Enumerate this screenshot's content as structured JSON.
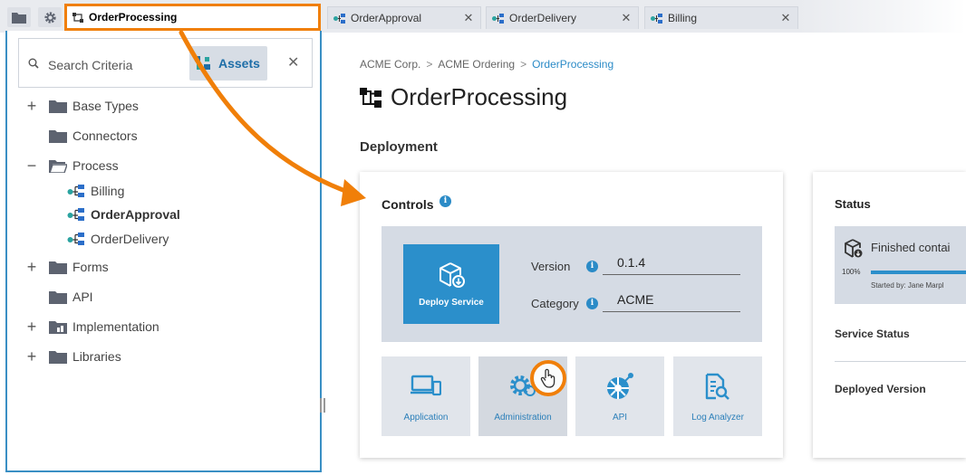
{
  "tabs": [
    {
      "label": "OrderProcessing",
      "active": true
    },
    {
      "label": "OrderApproval",
      "active": false
    },
    {
      "label": "OrderDelivery",
      "active": false
    },
    {
      "label": "Billing",
      "active": false
    }
  ],
  "sidebar": {
    "search_placeholder": "Search Criteria",
    "assets_label": "Assets",
    "tree": [
      {
        "label": "Base Types",
        "toggle": "+",
        "kind": "folder"
      },
      {
        "label": "Connectors",
        "toggle": "",
        "kind": "folder"
      },
      {
        "label": "Process",
        "toggle": "−",
        "kind": "folder-open"
      },
      {
        "label": "Billing",
        "kind": "process"
      },
      {
        "label": "OrderApproval",
        "kind": "process"
      },
      {
        "label": "OrderDelivery",
        "kind": "process"
      },
      {
        "label": "Forms",
        "toggle": "+",
        "kind": "folder"
      },
      {
        "label": "API",
        "toggle": "",
        "kind": "folder"
      },
      {
        "label": "Implementation",
        "toggle": "+",
        "kind": "folder-impl"
      },
      {
        "label": "Libraries",
        "toggle": "+",
        "kind": "folder"
      }
    ]
  },
  "breadcrumb": [
    "ACME Corp.",
    "ACME Ordering",
    "OrderProcessing"
  ],
  "page_title": "OrderProcessing",
  "section_title": "Deployment",
  "controls": {
    "title": "Controls",
    "deploy_label": "Deploy Service",
    "version_label": "Version",
    "version_value": "0.1.4",
    "category_label": "Category",
    "category_value": "ACME",
    "tiles": [
      "Application",
      "Administration",
      "API",
      "Log Analyzer"
    ]
  },
  "status": {
    "title": "Status",
    "state_text": "Finished contai",
    "progress_label": "100%",
    "progress_fraction": 1.0,
    "started_by": "Started by: Jane Marpl",
    "service_status_label": "Service Status",
    "deployed_version_label": "Deployed Version"
  },
  "colors": {
    "accent": "#2b8fcb",
    "annotation": "#f07f09",
    "panel": "#d5dbe4"
  },
  "icons": {
    "folder": "folder-icon",
    "gear": "gear-icon",
    "process": "process-icon",
    "search": "search-icon",
    "close": "close-icon",
    "info": "info-icon",
    "deploy": "package-download-icon",
    "cursor": "hand-pointer-icon"
  }
}
